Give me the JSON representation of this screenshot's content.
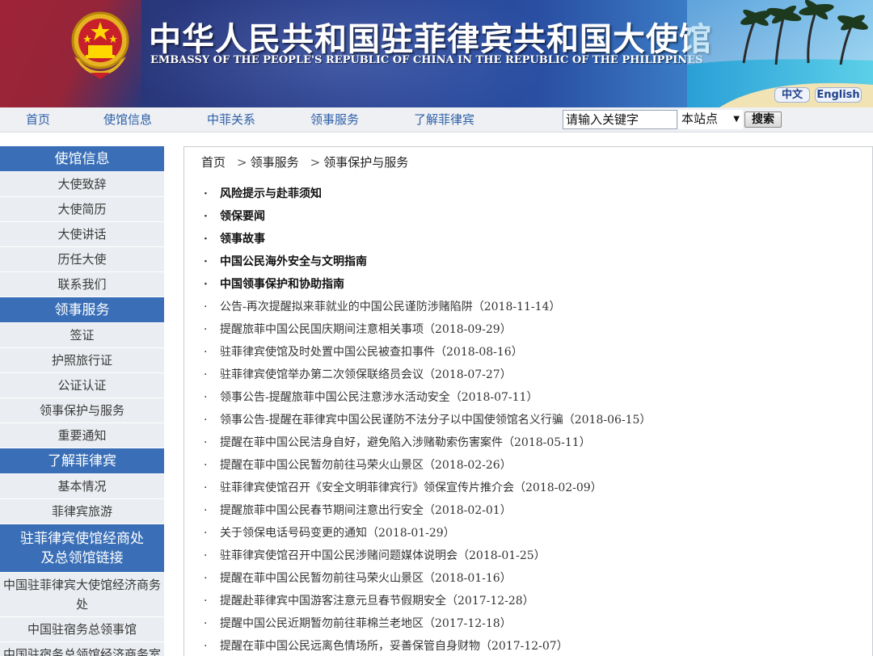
{
  "header": {
    "title_cn": "中华人民共和国驻菲律宾共和国大使馆",
    "title_en": "EMBASSY OF THE PEOPLE'S REPUBLIC OF CHINA IN THE REPUBLIC OF THE PHILIPPINES",
    "lang_cn": "中文",
    "lang_en": "English",
    "emblem_icon": "national-emblem-icon",
    "scene_icon": "palm-beach-scene-icon"
  },
  "nav": {
    "items": [
      "首页",
      "使馆信息",
      "中菲关系",
      "领事服务",
      "了解菲律宾"
    ],
    "search_value": "请输入关键字",
    "search_scope": "本站点",
    "search_button": "搜索"
  },
  "sidebar": {
    "sections": [
      {
        "title": "使馆信息",
        "items": [
          "大使致辞",
          "大使简历",
          "大使讲话",
          "历任大使",
          "联系我们"
        ]
      },
      {
        "title": "领事服务",
        "items": [
          "签证",
          "护照旅行证",
          "公证认证",
          "领事保护与服务",
          "重要通知"
        ]
      },
      {
        "title": "了解菲律宾",
        "items": [
          "基本情况",
          "菲律宾旅游"
        ]
      },
      {
        "title_line1": "驻菲律宾使馆经商处",
        "title_line2": "及总领馆链接",
        "items": [
          "中国驻菲律宾大使馆经济商务处",
          "中国驻宿务总领事馆",
          "中国驻宿务总领馆经济商务室"
        ]
      }
    ]
  },
  "breadcrumb": {
    "items": [
      "首页",
      "领事服务",
      "领事保护与服务"
    ],
    "separator": ">"
  },
  "news": {
    "bullet": "·",
    "categories": [
      "风险提示与赴菲须知",
      "领保要闻",
      "领事故事",
      "中国公民海外安全与文明指南",
      "中国领事保护和协助指南"
    ],
    "items": [
      "公告-再次提醒拟来菲就业的中国公民谨防涉赌陷阱（2018-11-14）",
      "提醒旅菲中国公民国庆期间注意相关事项（2018-09-29）",
      "驻菲律宾使馆及时处置中国公民被查扣事件（2018-08-16）",
      "驻菲律宾使馆举办第二次领保联络员会议（2018-07-27）",
      "领事公告-提醒旅菲中国公民注意涉水活动安全（2018-07-11）",
      "领事公告-提醒在菲律宾中国公民谨防不法分子以中国使领馆名义行骗（2018-06-15）",
      "提醒在菲中国公民洁身自好，避免陷入涉赌勒索伤害案件（2018-05-11）",
      "提醒在菲中国公民暂勿前往马荣火山景区（2018-02-26）",
      "驻菲律宾使馆召开《安全文明菲律宾行》领保宣传片推介会（2018-02-09）",
      "提醒旅菲中国公民春节期间注意出行安全（2018-02-01）",
      "关于领保电话号码变更的通知（2018-01-29）",
      "驻菲律宾使馆召开中国公民涉赌问题媒体说明会（2018-01-25）",
      "提醒在菲中国公民暂勿前往马荣火山景区（2018-01-16）",
      "提醒赴菲律宾中国游客注意元旦春节假期安全（2017-12-28）",
      "提醒中国公民近期暂勿前往菲棉兰老地区（2017-12-18）",
      "提醒在菲中国公民远离色情场所，妥善保管自身财物（2017-12-07）"
    ]
  }
}
